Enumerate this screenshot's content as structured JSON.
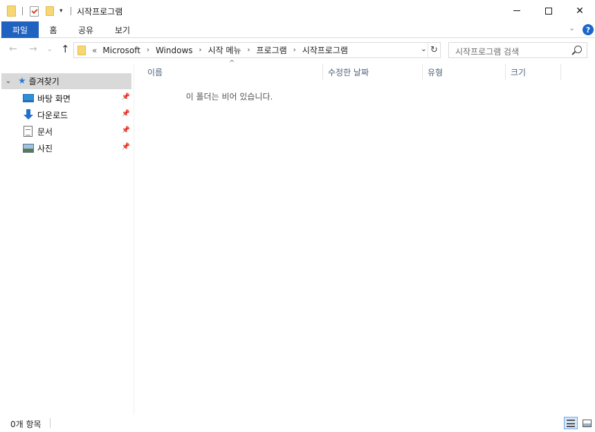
{
  "window": {
    "title": "시작프로그램",
    "minimize_icon": "minimize-icon",
    "maximize_icon": "maximize-icon",
    "close_glyph": "✕"
  },
  "quick_access_toolbar": {
    "icons": [
      "folder-icon",
      "properties-icon",
      "new-folder-icon",
      "customize-dropdown-icon"
    ],
    "dropdown_glyph": "▾"
  },
  "ribbon": {
    "tabs": [
      "파일",
      "홈",
      "공유",
      "보기"
    ],
    "expand_glyph": "⌄",
    "help_glyph": "?"
  },
  "navigation": {
    "back_glyph": "←",
    "forward_glyph": "→",
    "recent_glyph": "⌄",
    "up_glyph": "↑"
  },
  "address": {
    "overflow": "«",
    "crumbs": [
      "Microsoft",
      "Windows",
      "시작 메뉴",
      "프로그램",
      "시작프로그램"
    ],
    "arrow": "›",
    "dropdown_glyph": "⌄",
    "refresh_glyph": "↻"
  },
  "search": {
    "placeholder": "시작프로그램 검색"
  },
  "nav_pane": {
    "quick_access": {
      "label": "즐겨찾기",
      "chevron": "⌄",
      "star": "★"
    },
    "items": [
      {
        "label": "바탕 화면",
        "icon": "desktop-icon",
        "pin": "📌"
      },
      {
        "label": "다운로드",
        "icon": "download-icon",
        "pin": "📌"
      },
      {
        "label": "문서",
        "icon": "documents-icon",
        "pin": "📌"
      },
      {
        "label": "사진",
        "icon": "pictures-icon",
        "pin": "📌"
      }
    ]
  },
  "columns": [
    "이름",
    "수정한 날짜",
    "유형",
    "크기"
  ],
  "sort_glyph": "^",
  "empty_message": "이 폴더는 비어 있습니다.",
  "status": {
    "item_count": "0개 항목"
  },
  "colors": {
    "file_tab": "#1f62c0",
    "selection": "#d9d9d9",
    "folder": "#f7d774",
    "accent": "#2a7bd1"
  }
}
